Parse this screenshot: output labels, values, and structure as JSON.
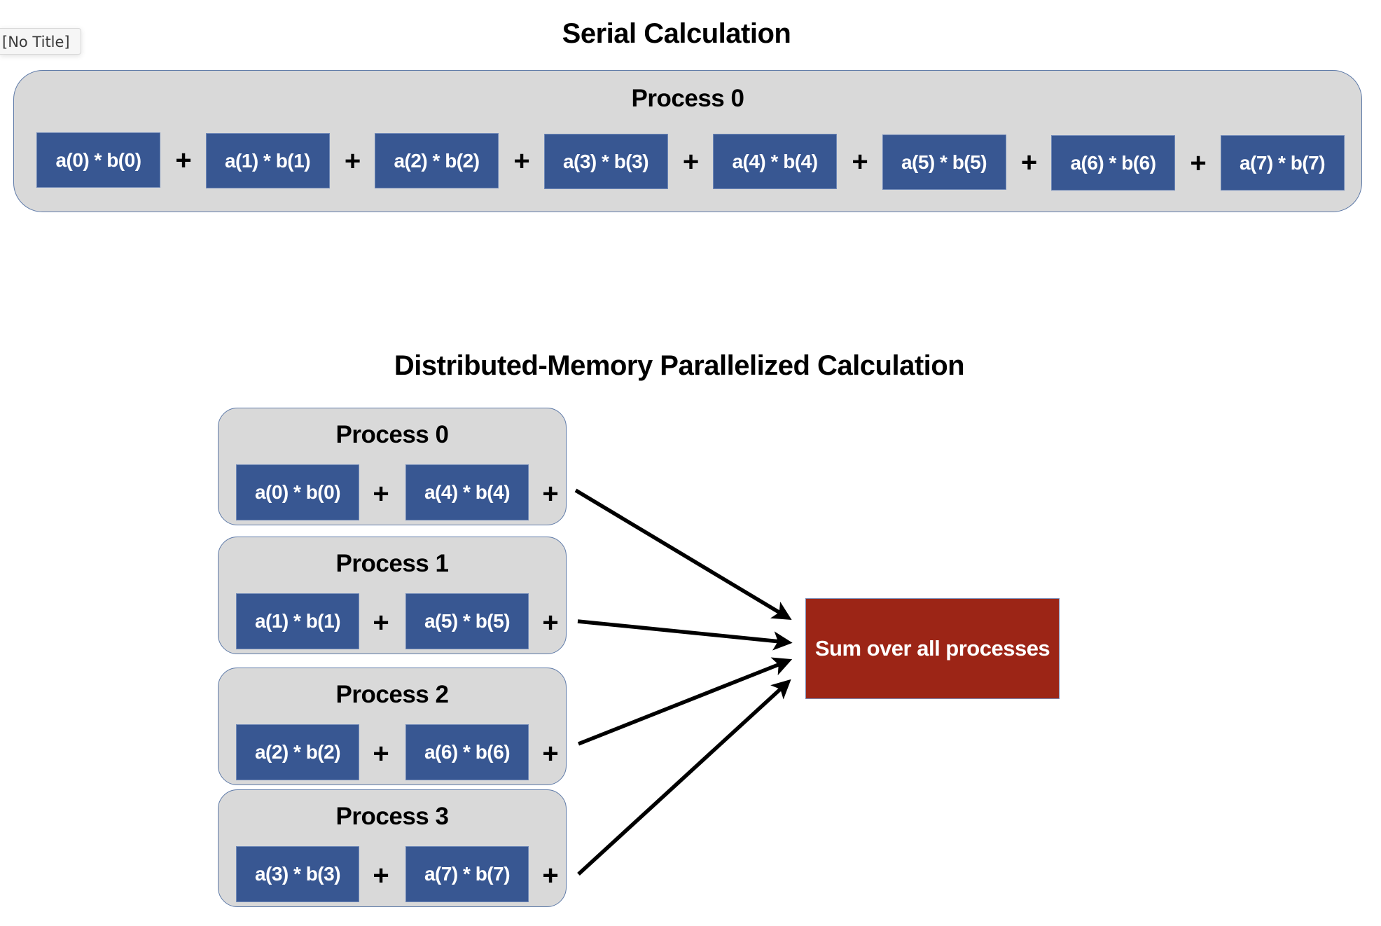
{
  "window": {
    "tooltip_title": "[No Title]"
  },
  "serial": {
    "title": "Serial Calculation",
    "process": {
      "label": "Process 0",
      "terms": [
        "a(0) * b(0)",
        "a(1) * b(1)",
        "a(2) * b(2)",
        "a(3) * b(3)",
        "a(4) * b(4)",
        "a(5) * b(5)",
        "a(6) * b(6)",
        "a(7) * b(7)"
      ]
    },
    "operator": "+"
  },
  "parallel": {
    "title": "Distributed-Memory Parallelized Calculation",
    "operator": "+",
    "processes": [
      {
        "label": "Process 0",
        "terms": [
          "a(0) * b(0)",
          "a(4) * b(4)"
        ]
      },
      {
        "label": "Process 1",
        "terms": [
          "a(1) * b(1)",
          "a(5) * b(5)"
        ]
      },
      {
        "label": "Process 2",
        "terms": [
          "a(2) * b(2)",
          "a(6) * b(6)"
        ]
      },
      {
        "label": "Process 3",
        "terms": [
          "a(3) * b(3)",
          "a(7) * b(7)"
        ]
      }
    ],
    "reduction": {
      "label": "Sum over all processes"
    }
  },
  "colors": {
    "term_fill": "#385792",
    "process_fill": "#d9d9d9",
    "process_border": "#5e7aa8",
    "sum_fill": "#9c2516",
    "arrow": "#000000"
  }
}
